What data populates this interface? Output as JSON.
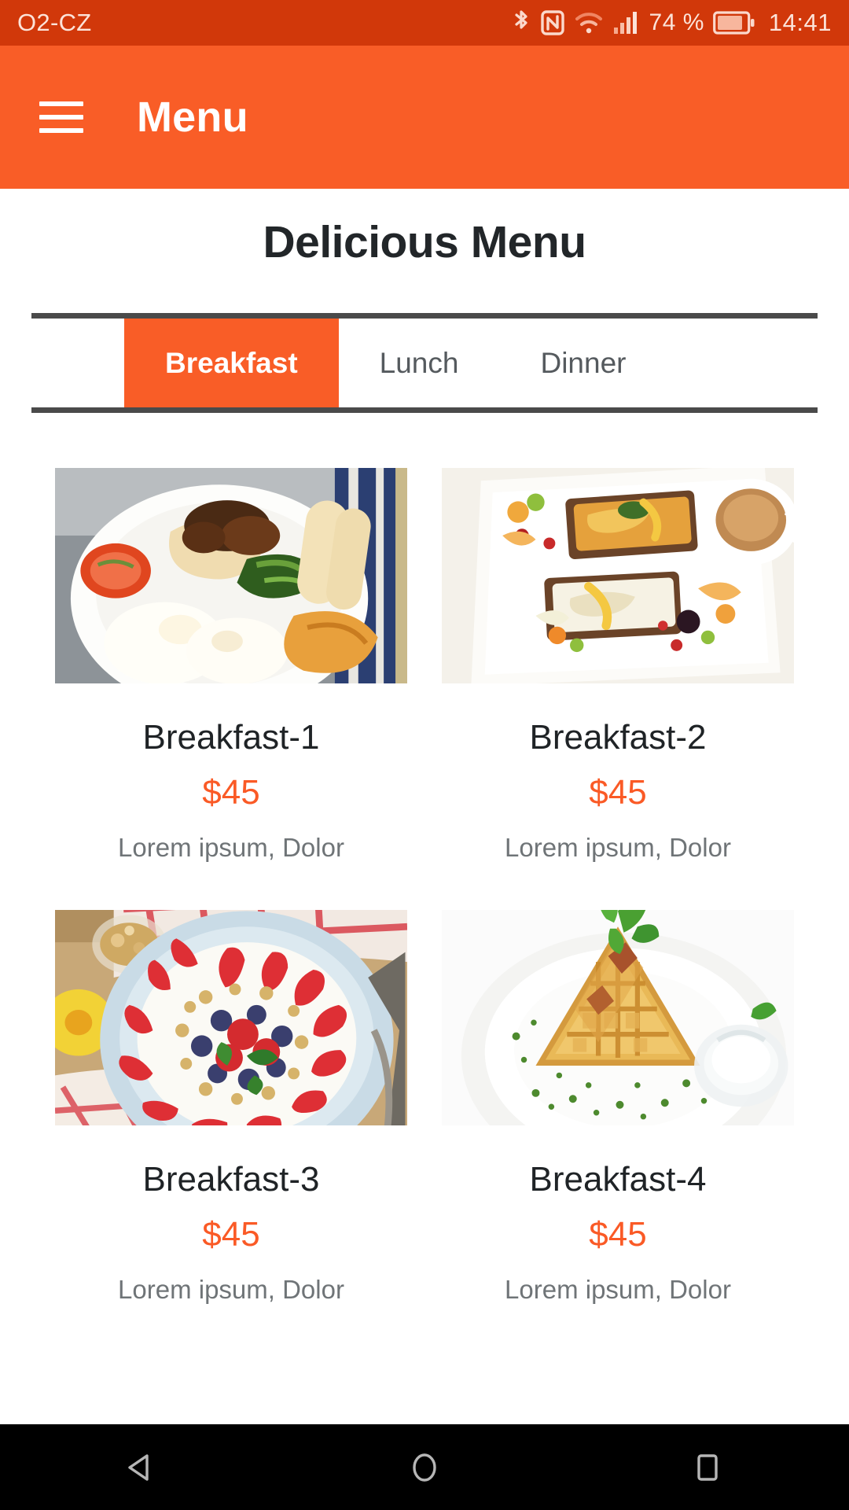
{
  "statusbar": {
    "carrier": "O2-CZ",
    "battery_percent": "74 %",
    "clock": "14:41",
    "icons": [
      "bluetooth-icon",
      "nfc-icon",
      "wifi-icon",
      "signal-icon",
      "battery-icon"
    ]
  },
  "appbar": {
    "menu_icon": "hamburger-menu-icon",
    "title": "Menu"
  },
  "page": {
    "title": "Delicious Menu"
  },
  "tabs": [
    {
      "label": "Breakfast",
      "active": true
    },
    {
      "label": "Lunch",
      "active": false
    },
    {
      "label": "Dinner",
      "active": false
    }
  ],
  "items": [
    {
      "image": "breakfast-plate-eggs-tomato",
      "title": "Breakfast-1",
      "price": "$45",
      "description": "Lorem ipsum, Dolor"
    },
    {
      "image": "breakfast-toast-platter",
      "title": "Breakfast-2",
      "price": "$45",
      "description": "Lorem ipsum, Dolor"
    },
    {
      "image": "breakfast-yogurt-berry-bowl",
      "title": "Breakfast-3",
      "price": "$45",
      "description": "Lorem ipsum, Dolor"
    },
    {
      "image": "breakfast-waffles-plate",
      "title": "Breakfast-4",
      "price": "$45",
      "description": "Lorem ipsum, Dolor"
    }
  ],
  "navbar": {
    "back_label": "back-button",
    "home_label": "home-button",
    "recents_label": "recents-button"
  },
  "colors": {
    "status_bar": "#d1380a",
    "app_bar": "#f95d27",
    "accent": "#fa5a26",
    "tab_border": "#4a4a4a",
    "title_text": "#222629",
    "desc_text": "#6f7477"
  }
}
